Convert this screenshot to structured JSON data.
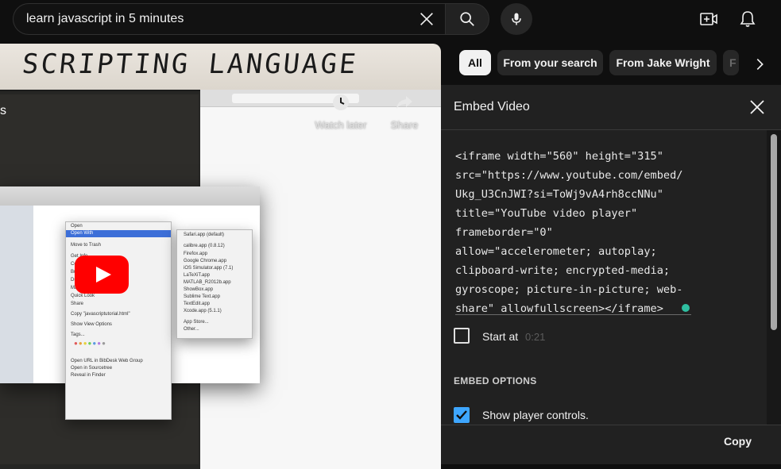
{
  "search": {
    "query": "learn javascript in 5 minutes"
  },
  "icons": {
    "clear": "close-icon",
    "search": "search-icon",
    "mic": "microphone-icon",
    "create": "create-video-icon",
    "notifications": "bell-icon",
    "play": "youtube-play-icon",
    "watch_later": "clock-icon",
    "share": "share-arrow-icon",
    "chips_next": "chevron-right-icon",
    "close_panel": "close-icon",
    "checked": "checkmark-icon"
  },
  "video": {
    "whiteboard_text": "SCRIPTING LANGUAGE",
    "title_fragment": "s",
    "watch_later_label": "Watch later",
    "share_label": "Share",
    "context_menu": [
      "Open",
      "Open With",
      "Move to Trash",
      "Get Info",
      "Compress",
      "Burn",
      "Duplicate",
      "Make Alias",
      "Quick Look",
      "Share",
      "Copy \"javascriptutorial.html\"",
      "Show View Options",
      "Tags...",
      "Open URL in BibDesk Web Group",
      "Open in Sourcetree",
      "Reveal in Finder"
    ],
    "open_with_menu": [
      "Safari.app (default)",
      "calibre.app (0.8.12)",
      "Firefox.app",
      "Google Chrome.app",
      "iOS Simulator.app (7.1)",
      "LaTeXiT.app",
      "MATLAB_R2012b.app",
      "ShowBox.app",
      "Sublime Text.app",
      "TextEdit.app",
      "Xcode.app (5.1.1)",
      "App Store...",
      "Other..."
    ]
  },
  "chips": [
    {
      "label": "All",
      "active": true
    },
    {
      "label": "From your search",
      "active": false
    },
    {
      "label": "From Jake Wright",
      "active": false
    },
    {
      "label": "F",
      "active": false
    }
  ],
  "embed": {
    "title": "Embed Video",
    "code_lines": [
      "<iframe width=\"560\" height=\"315\"",
      "src=\"https://www.youtube.com/embed/",
      "Ukg_U3CnJWI?si=ToWj9vA4rh8ccNNu\"",
      "title=\"YouTube video player\"",
      "frameborder=\"0\"",
      "allow=\"accelerometer; autoplay;",
      "clipboard-write; encrypted-media;",
      "gyroscope; picture-in-picture; web-",
      "share\" allowfullscreen></iframe>"
    ],
    "start_at_label": "Start at",
    "start_at_time": "0:21",
    "start_at_checked": false,
    "options_title": "EMBED OPTIONS",
    "show_controls_label": "Show player controls.",
    "show_controls_checked": true,
    "copy_label": "Copy"
  },
  "colors": {
    "background": "#0f0f0f",
    "panel": "#212121",
    "accent_blue": "#3ea6ff",
    "youtube_red": "#ff0000",
    "status_dot": "#2fbfa1"
  }
}
